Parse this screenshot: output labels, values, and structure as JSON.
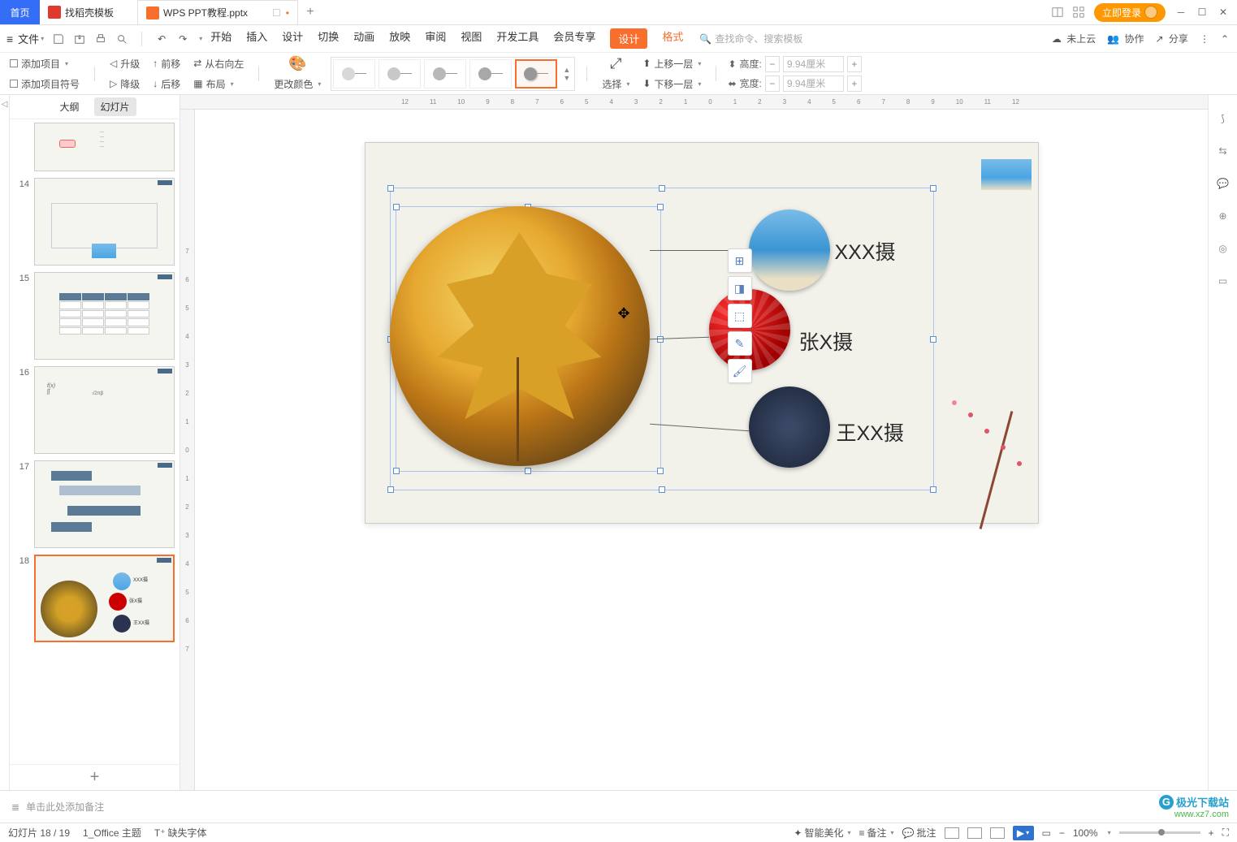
{
  "tabs": {
    "home": "首页",
    "docao": "找稻壳模板",
    "active": "WPS PPT教程.pptx"
  },
  "login": "立即登录",
  "file_menu": "文件",
  "menu": {
    "start": "开始",
    "insert": "插入",
    "design": "设计",
    "transition": "切换",
    "animation": "动画",
    "slideshow": "放映",
    "review": "审阅",
    "view": "视图",
    "devtools": "开发工具",
    "member": "会员专享",
    "design2": "设计",
    "format": "格式"
  },
  "search_placeholder": "查找命令、搜索模板",
  "right": {
    "notcloud": "未上云",
    "coop": "协作",
    "share": "分享"
  },
  "ribbon": {
    "add_item": "添加项目",
    "add_bullet": "添加项目符号",
    "promote": "升级",
    "demote": "降级",
    "move_before": "前移",
    "move_after": "后移",
    "rtl": "从右向左",
    "layout": "布局",
    "change_color": "更改颜色",
    "select": "选择",
    "up_layer": "上移一层",
    "down_layer": "下移一层",
    "height": "高度:",
    "width": "宽度:",
    "h_val": "9.94厘米",
    "w_val": "9.94厘米"
  },
  "sp_tabs": {
    "outline": "大纲",
    "slides": "幻灯片"
  },
  "slide": {
    "label1": "XXX摄",
    "label2": "张X摄",
    "label3": "王XX摄"
  },
  "thumbs": [
    {
      "num": ""
    },
    {
      "num": "14"
    },
    {
      "num": "15"
    },
    {
      "num": "16"
    },
    {
      "num": "17"
    },
    {
      "num": "18"
    }
  ],
  "notes_placeholder": "单击此处添加备注",
  "status": {
    "slide_pos": "幻灯片 18 / 19",
    "theme": "1_Office 主题",
    "missing_font": "缺失字体",
    "smart": "智能美化",
    "notes": "备注",
    "comments": "批注",
    "zoom": "100%"
  },
  "watermark": {
    "name": "极光下载站",
    "url": "www.xz7.com"
  },
  "ruler_h": [
    "12",
    "11",
    "10",
    "9",
    "8",
    "7",
    "6",
    "5",
    "4",
    "3",
    "2",
    "1",
    "0",
    "1",
    "2",
    "3",
    "4",
    "5",
    "6",
    "7",
    "8",
    "9",
    "10",
    "11",
    "12"
  ],
  "ruler_v": [
    "7",
    "6",
    "5",
    "4",
    "3",
    "2",
    "1",
    "0",
    "1",
    "2",
    "3",
    "4",
    "5",
    "6",
    "7"
  ]
}
